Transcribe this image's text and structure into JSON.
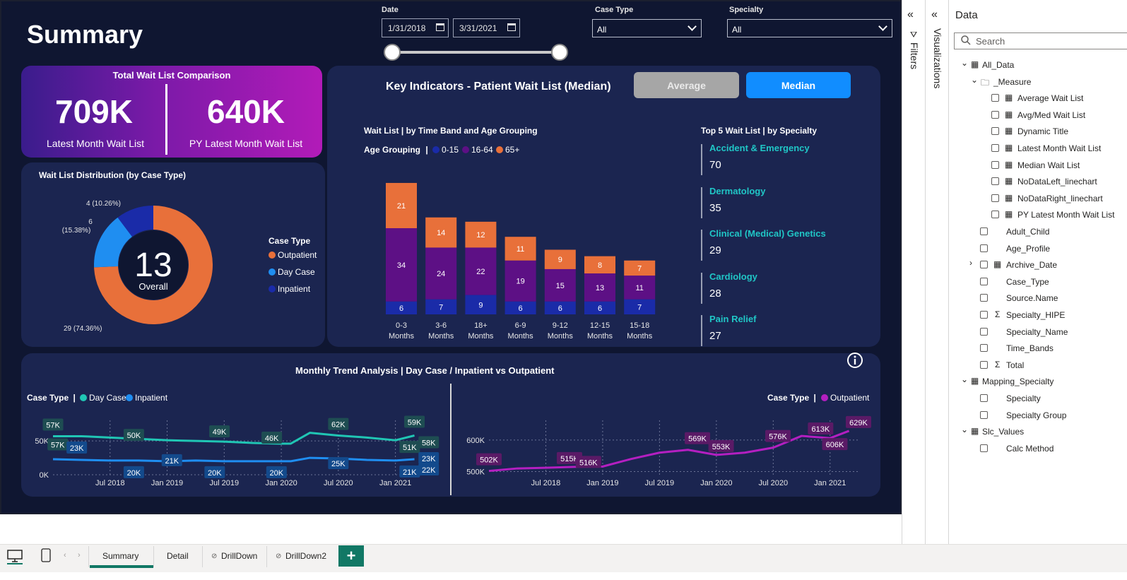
{
  "report": {
    "title": "Summary"
  },
  "slicers": {
    "date": {
      "label": "Date",
      "start": "1/31/2018",
      "end": "3/31/2021"
    },
    "case_type": {
      "label": "Case Type",
      "value": "All"
    },
    "specialty": {
      "label": "Specialty",
      "value": "All"
    }
  },
  "kpi": {
    "title": "Total Wait List Comparison",
    "latest_value": "709K",
    "latest_label": "Latest Month Wait List",
    "py_value": "640K",
    "py_label": "PY Latest Month Wait List"
  },
  "key_indicators": {
    "title": "Key Indicators - Patient Wait List (Median)",
    "average_button": "Average",
    "median_button": "Median"
  },
  "distribution": {
    "title": "Wait List Distribution (by Case Type)",
    "center_value": "13",
    "center_label": "Overall",
    "legend_title": "Case Type",
    "colors": {
      "outpatient": "#e8703a",
      "day_case": "#1f8ef1",
      "inpatient": "#1a2ba8"
    }
  },
  "time_band": {
    "title": "Wait List | by Time Band and Age Grouping",
    "legend_title": "Age Grouping",
    "legend_sep": "|",
    "colors": {
      "a015": "#1a2ba8",
      "a1664": "#5d1085",
      "a65": "#e8703a"
    }
  },
  "top5": {
    "title": "Top 5 Wait List | by Specialty",
    "items": [
      {
        "name": "Accident & Emergency",
        "value": "70"
      },
      {
        "name": "Dermatology",
        "value": "35"
      },
      {
        "name": "Clinical (Medical) Genetics",
        "value": "29"
      },
      {
        "name": "Cardiology",
        "value": "28"
      },
      {
        "name": "Pain Relief",
        "value": "27"
      }
    ]
  },
  "trend": {
    "title": "Monthly Trend Analysis | Day Case / Inpatient vs Outpatient",
    "left_legend_title": "Case Type",
    "right_legend_title": "Case Type",
    "legend_sep": "|",
    "colors": {
      "day_case": "#20c6b4",
      "inpatient": "#1f8ef1",
      "outpatient": "#b41fc1"
    }
  },
  "chart_data": [
    {
      "type": "pie",
      "title": "Wait List Distribution (by Case Type)",
      "categories": [
        "Outpatient",
        "Day Case",
        "Inpatient"
      ],
      "values": [
        29,
        6,
        4
      ],
      "data_labels": [
        "29 (74.36%)",
        "6 (15.38%)",
        "4 (10.26%)"
      ]
    },
    {
      "type": "bar",
      "stacked": true,
      "title": "Wait List | by Time Band and Age Grouping",
      "categories": [
        "0-3 Months",
        "3-6 Months",
        "18+ Months",
        "6-9 Months",
        "9-12 Months",
        "12-15 Months",
        "15-18 Months"
      ],
      "series": [
        {
          "name": "0-15",
          "values": [
            6,
            7,
            9,
            6,
            6,
            6,
            7
          ]
        },
        {
          "name": "16-64",
          "values": [
            34,
            24,
            22,
            19,
            15,
            13,
            11
          ]
        },
        {
          "name": "65+",
          "values": [
            21,
            14,
            12,
            11,
            9,
            8,
            7
          ]
        }
      ]
    },
    {
      "type": "line",
      "title": "Day Case / Inpatient",
      "x_ticks": [
        "Jul 2018",
        "Jan 2019",
        "Jul 2019",
        "Jan 2020",
        "Jul 2020",
        "Jan 2021"
      ],
      "y_ticks": [
        "0K",
        "50K"
      ],
      "ylim": [
        0,
        70
      ],
      "x": [
        "2018-01",
        "2018-04",
        "2018-07",
        "2018-10",
        "2019-01",
        "2019-04",
        "2019-07",
        "2019-10",
        "2020-01",
        "2020-02",
        "2020-04",
        "2020-07",
        "2020-10",
        "2021-01",
        "2021-03"
      ],
      "series": [
        {
          "name": "Day Case",
          "values": [
            57,
            57,
            55,
            53,
            51,
            50,
            49,
            47,
            46,
            46,
            62,
            58,
            55,
            51,
            58
          ]
        },
        {
          "name": "Inpatient",
          "values": [
            23,
            22,
            21,
            21,
            20,
            21,
            20,
            20,
            20,
            20,
            25,
            24,
            22,
            21,
            23
          ]
        }
      ],
      "data_labels": [
        "57K",
        "57K",
        "23K",
        "50K",
        "20K",
        "49K",
        "21K",
        "20K",
        "46K",
        "20K",
        "62K",
        "25K",
        "59K",
        "51K",
        "21K",
        "58K",
        "23K",
        "22K"
      ]
    },
    {
      "type": "line",
      "title": "Outpatient",
      "x_ticks": [
        "Jul 2018",
        "Jan 2019",
        "Jul 2019",
        "Jan 2020",
        "Jul 2020",
        "Jan 2021"
      ],
      "y_ticks": [
        "500K",
        "600K"
      ],
      "ylim": [
        490,
        640
      ],
      "x": [
        "2018-01",
        "2018-04",
        "2018-07",
        "2018-10",
        "2019-01",
        "2019-04",
        "2019-07",
        "2019-10",
        "2020-01",
        "2020-04",
        "2020-07",
        "2020-10",
        "2021-01",
        "2021-03"
      ],
      "series": [
        {
          "name": "Outpatient",
          "values": [
            502,
            510,
            512,
            515,
            516,
            540,
            560,
            569,
            553,
            560,
            576,
            613,
            606,
            629
          ]
        }
      ],
      "data_labels": [
        "502K",
        "515K",
        "516K",
        "569K",
        "553K",
        "576K",
        "613K",
        "606K",
        "629K"
      ]
    }
  ],
  "panes": {
    "filters": "Filters",
    "visualizations": "Visualizations",
    "data": "Data",
    "search_placeholder": "Search"
  },
  "fields": {
    "all_data": "All_Data",
    "measure": "_Measure",
    "measures": [
      "Average Wait List",
      "Avg/Med Wait List",
      "Dynamic Title",
      "Latest Month Wait List",
      "Median Wait List",
      "NoDataLeft_linechart",
      "NoDataRight_linechart",
      "PY Latest Month Wait List"
    ],
    "columns": [
      "Adult_Child",
      "Age_Profile",
      "Archive_Date",
      "Case_Type",
      "Source.Name",
      "Specialty_HIPE",
      "Specialty_Name",
      "Time_Bands",
      "Total"
    ],
    "mapping": "Mapping_Specialty",
    "mapping_cols": [
      "Specialty",
      "Specialty Group"
    ],
    "slc": "Slc_Values",
    "slc_cols": [
      "Calc Method"
    ]
  },
  "tabs": [
    "Summary",
    "Detail",
    "DrillDown",
    "DrillDown2"
  ],
  "add_tab": "+"
}
